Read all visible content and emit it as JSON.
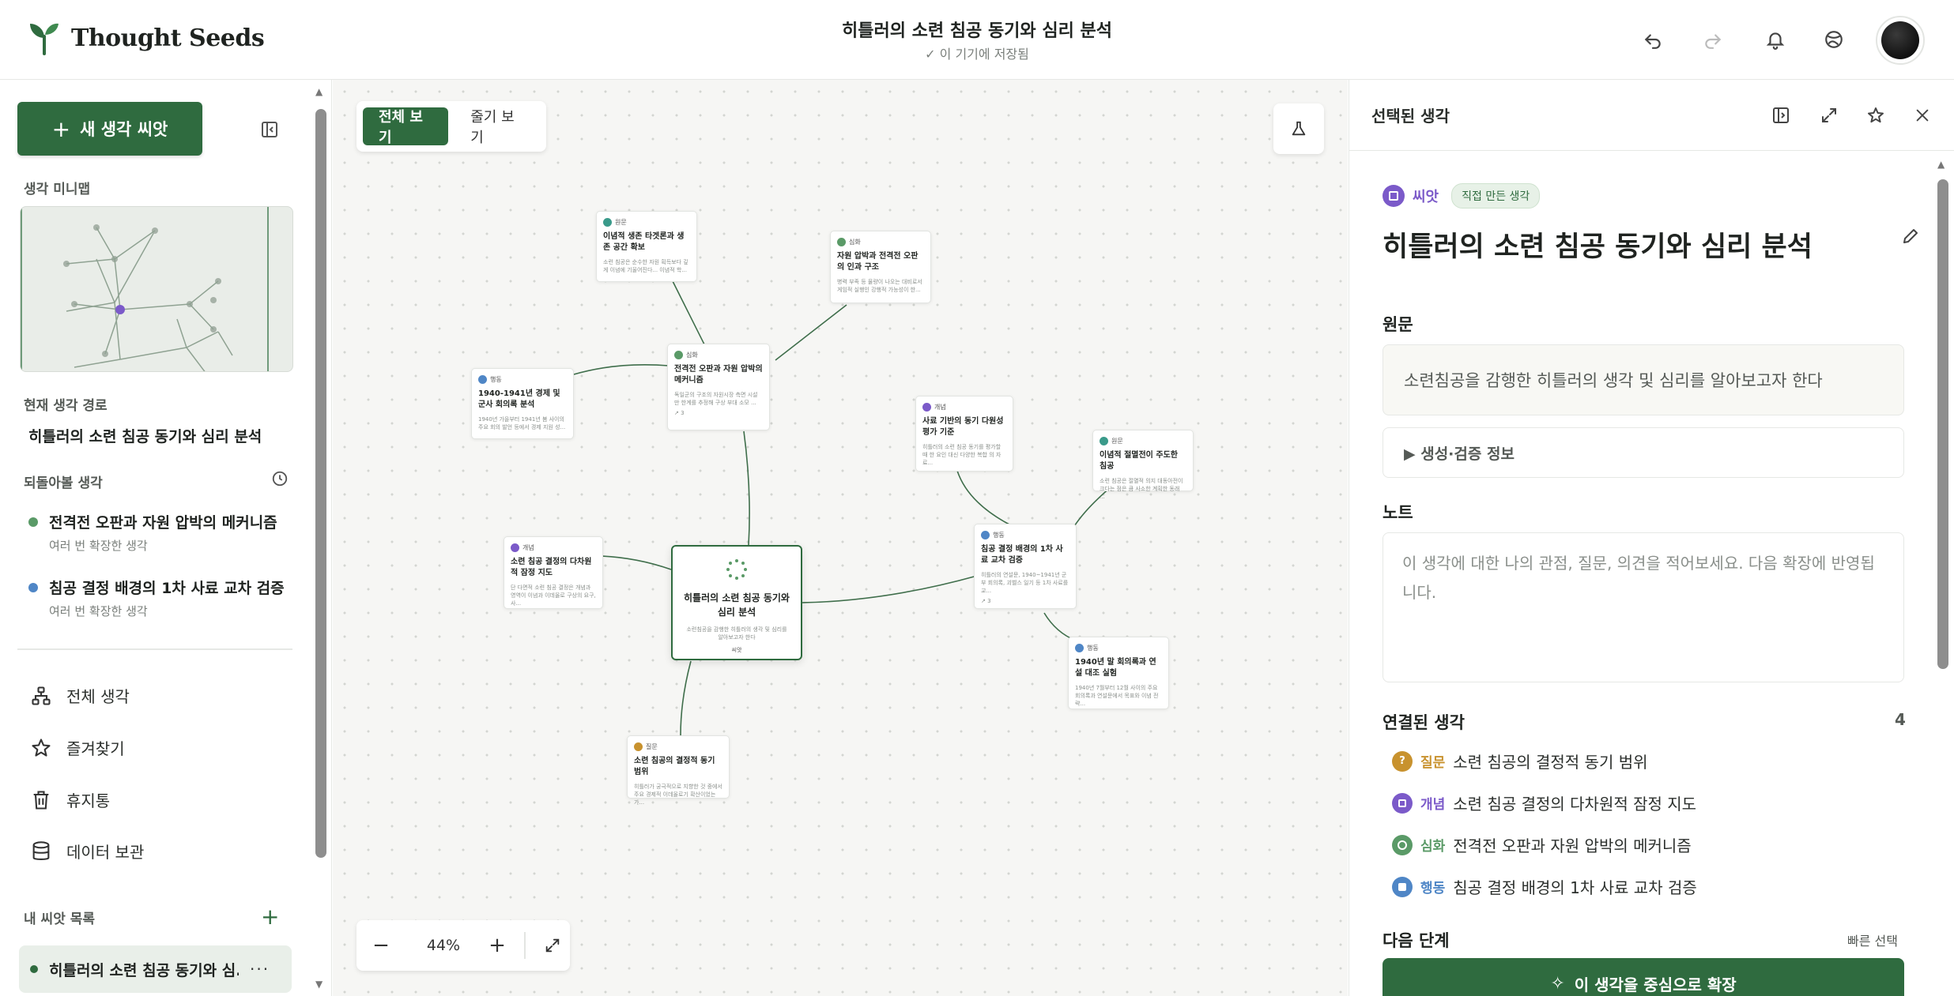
{
  "app": {
    "brand": "Thought Seeds",
    "doc_title": "히틀러의 소련 침공 동기와 심리 분석",
    "save_status": "이 기기에 저장됨"
  },
  "sidebar": {
    "new_seed_label": "새 생각 씨앗",
    "minimap_label": "생각 미니맵",
    "path_label": "현재 생각 경로",
    "path_title": "히틀러의 소련 침공 동기와 심리 분석",
    "recall_label": "되돌아볼 생각",
    "recall_items": [
      {
        "title": "전격전 오판과 자원 압박의 메커니즘",
        "sub": "여러 번 확장한 생각",
        "color": "#5a9a67"
      },
      {
        "title": "침공 결정 배경의 1차 사료 교차 검증",
        "sub": "여러 번 확장한 생각",
        "color": "#4f86c6"
      }
    ],
    "nav": [
      {
        "label": "전체 생각",
        "icon": "hierarchy-icon"
      },
      {
        "label": "즐겨찾기",
        "icon": "star-icon"
      },
      {
        "label": "휴지통",
        "icon": "trash-icon"
      },
      {
        "label": "데이터 보관",
        "icon": "database-icon"
      }
    ],
    "seed_list_label": "내 씨앗 목록",
    "seed_list_add": "+",
    "seed_items": [
      {
        "title": "히틀러의 소련 침공 동기와 심...",
        "more": "···"
      }
    ]
  },
  "canvas": {
    "view_all": "전체 보기",
    "view_trunk": "줄기 보기",
    "zoom": "44%",
    "zoom_minus": "−",
    "zoom_plus": "+",
    "center": {
      "title": "히틀러의 소련 침공 동기와 심리 분석",
      "body": "소련침공을 감행한 히틀러의 생각 및 심리를 알아보고자 한다",
      "tag": "씨앗"
    },
    "nodes": [
      {
        "tag": "원문",
        "title": "이념적 생존 타겟론과 생존 공간 확보",
        "body": "소련 침공은 순수한 자원 획득보다 깊게 이념에 기울어진다... 이념적 학..."
      },
      {
        "tag": "심화",
        "title": "자원 압박과 전격전 오판의 인과 구조",
        "body": "병력 부족 등 물량이 나오는 대비로서 게임적 실행인 강행적 가능성이 한..."
      },
      {
        "tag": "행동",
        "title": "1940-1941년 경제 및 군사 회의록 분석",
        "body": "1940년 가을부터 1941년 봄 사이의 주요 회의 발언 등에서 경제 지원 성..."
      },
      {
        "tag": "심화",
        "title": "전격전 오판과 자원 압박의 메커니즘",
        "body": "독일군의 구조의 자원시장 측면 시설 만 한계를 추정해 구상 부대 소모 ...",
        "foot": "3"
      },
      {
        "tag": "개념",
        "title": "사료 기반의 동기 다원성 평가 기준",
        "body": "히틀러의 소련 침공 동기를 평가할 때 한 요인 대신 다양한 복합 의 자료..."
      },
      {
        "tag": "원문",
        "title": "이념적 절멸전이 주도한 침공",
        "body": "소련 침공은 절멸적 의지 대동아전이 크다는 점은 큼 사소한 계획한 동래 ..."
      },
      {
        "tag": "개념",
        "title": "소련 침공 결정의 다차원적 잠정 지도",
        "body": "단 다면적 소련 침공 결정은 개념과 영역이 이념과 이데올로 구상의 요구, 사..."
      },
      {
        "tag": "행동",
        "title": "침공 결정 배경의 1차 사료 교차 검증",
        "body": "히틀러의 연설문, 1940~1941년 군부 회의록, 괴벨스 일기 등 1차 사료를 교...",
        "foot": "3"
      },
      {
        "tag": "행동",
        "title": "1940년 말 회의록과 연설 대조 실험",
        "body": "1940년 7월부터 12월 사이의 주요 회의록과 연설문에서 목표와 이념 전략..."
      },
      {
        "tag": "질문",
        "title": "소련 침공의 결정적 동기 범위",
        "body": "히틀러가 궁극적으로 지향한 것 중에서 주요 경제적 이데올로기 확산이었는가..."
      }
    ]
  },
  "panel": {
    "header": "선택된 생각",
    "kind": "씨앗",
    "kind_badge": "직접 만든 생각",
    "title": "히틀러의 소련 침공 동기와 심리 분석",
    "original_label": "원문",
    "original_text": "소련침공을 감행한 히틀러의 생각 및 심리를 알아보고자 한다",
    "gen_info": "▶ 생성·검증 정보",
    "note_label": "노트",
    "note_placeholder": "이 생각에 대한 나의 관점, 질문, 의견을 적어보세요. 다음 확장에 반영됩니다.",
    "connected_label": "연결된 생각",
    "connected_count": "4",
    "connected": [
      {
        "type": "질문",
        "title": "소련 침공의 결정적 동기 범위",
        "color": "#c8922e"
      },
      {
        "type": "개념",
        "title": "소련 침공 결정의 다차원적 잠정 지도",
        "color": "#7b5ac9"
      },
      {
        "type": "심화",
        "title": "전격전 오판과 자원 압박의 메커니즘",
        "color": "#5a9a67"
      },
      {
        "type": "행동",
        "title": "침공 결정 배경의 1차 사료 교차 검증",
        "color": "#4f86c6"
      }
    ],
    "next_label": "다음 단계",
    "quick_label": "빠른 선택",
    "expand_label": "이 생각을 중심으로 확장"
  }
}
